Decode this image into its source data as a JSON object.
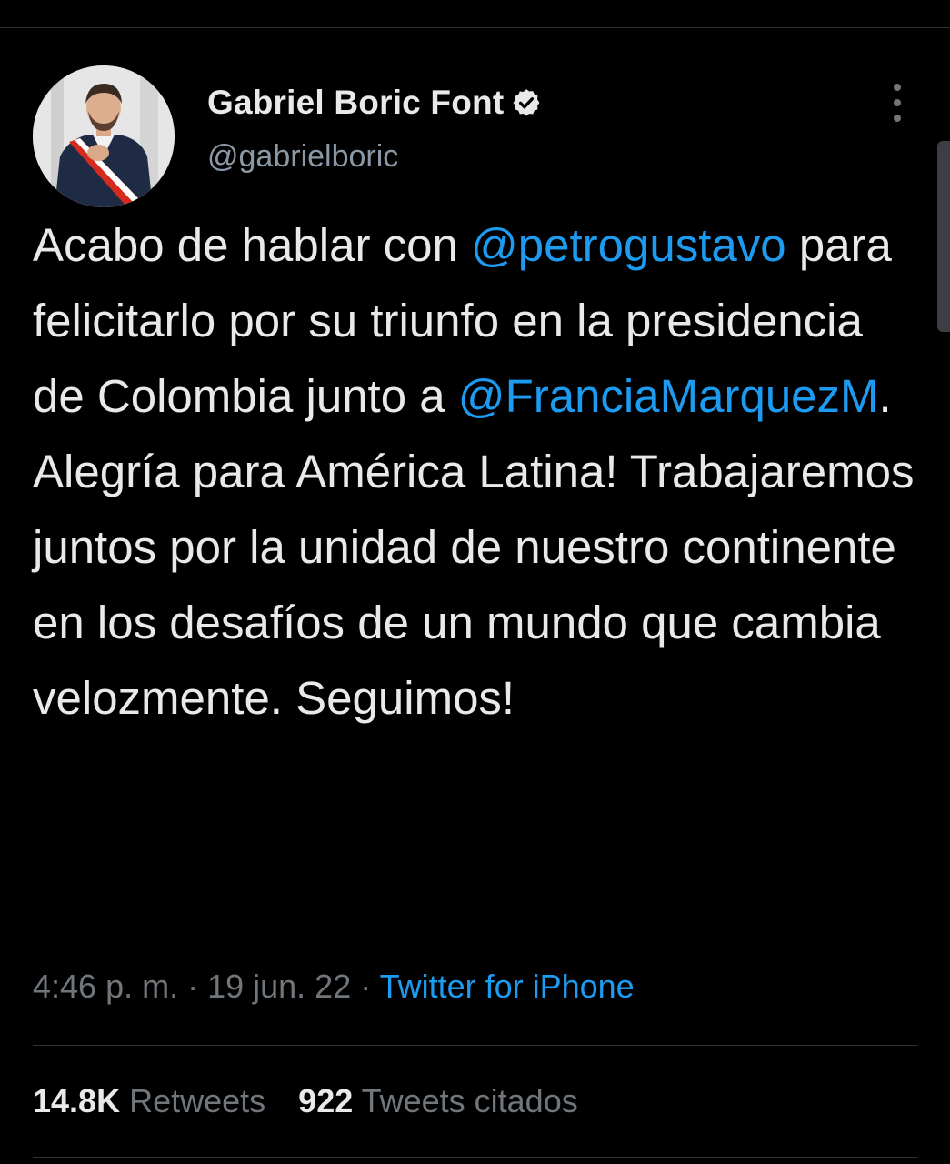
{
  "author": {
    "display_name": "Gabriel Boric Font",
    "handle": "@gabrielboric",
    "verified": true,
    "avatar_icon": "avatar-photo"
  },
  "tweet": {
    "segments": [
      {
        "type": "text",
        "text": "Acabo de hablar con "
      },
      {
        "type": "mention",
        "text": "@petrogustavo"
      },
      {
        "type": "text",
        "text": " para felicitarlo por su triunfo en la presidencia de Colombia junto a "
      },
      {
        "type": "mention",
        "text": "@FranciaMarquezM"
      },
      {
        "type": "text",
        "text": ". Alegría para América Latina! Trabajaremos juntos por la unidad de nuestro continente en los desafíos de un mundo que cambia velozmente. Seguimos!"
      }
    ]
  },
  "meta": {
    "time": "4:46 p. m.",
    "separator": " · ",
    "date": "19 jun. 22",
    "source": "Twitter for iPhone"
  },
  "stats": {
    "retweets_count": "14.8K",
    "retweets_label": "Retweets",
    "quotes_count": "922",
    "quotes_label": "Tweets citados"
  },
  "colors": {
    "background": "#000000",
    "text": "#e7e9ea",
    "secondary": "#71767b",
    "accent": "#1d9bf0"
  }
}
